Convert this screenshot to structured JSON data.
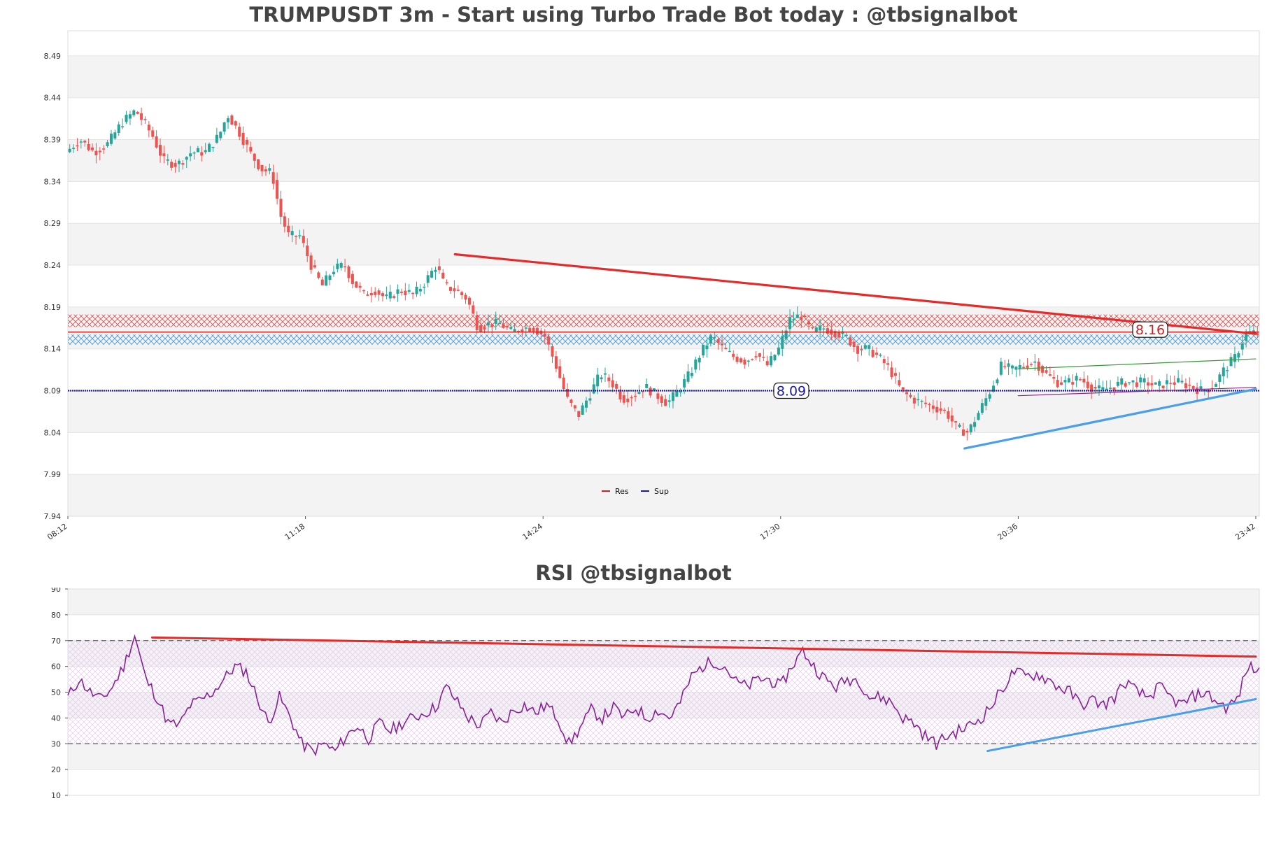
{
  "chart_data": [
    {
      "type": "candlestick",
      "title": "TRUMPUSDT 3m - Start using Turbo Trade Bot today : @tbsignalbot",
      "ylim": [
        7.94,
        8.52
      ],
      "y_ticks": [
        "8.49",
        "8.44",
        "8.39",
        "8.34",
        "8.29",
        "8.24",
        "8.19",
        "8.14",
        "8.09",
        "8.04",
        "7.99",
        "7.94"
      ],
      "x_ticks": [
        "08:12",
        "11:18",
        "14:24",
        "17:30",
        "20:36",
        "23:42"
      ],
      "n_candles": 316,
      "legend": {
        "placement": "bottom-center",
        "entries": [
          "Res",
          "Sup"
        ]
      },
      "levels": [
        {
          "name": "Res",
          "value": 8.16,
          "label": "8.16",
          "color": "#cc2222",
          "zone": [
            8.166,
            8.181
          ]
        },
        {
          "name": "Sup",
          "value": 8.09,
          "label": "8.09",
          "color": "#1a1aaa",
          "zone": [
            8.145,
            8.157
          ]
        }
      ],
      "trendlines": [
        {
          "name": "resistance-trend",
          "color": "#e52a2a",
          "from": [
            "13:15",
            8.253
          ],
          "to": [
            "23:42",
            8.158
          ]
        },
        {
          "name": "support-trend",
          "color": "#4a9fe8",
          "from": [
            "19:54",
            8.021
          ],
          "to": [
            "23:42",
            8.092
          ]
        },
        {
          "name": "channel-upper",
          "color": "#3a9a3a",
          "from": [
            "20:36",
            8.116
          ],
          "to": [
            "23:42",
            8.128
          ]
        },
        {
          "name": "channel-lower",
          "color": "#8a2a8a",
          "from": [
            "20:36",
            8.084
          ],
          "to": [
            "23:42",
            8.094
          ]
        }
      ],
      "anchors": [
        [
          0,
          8.375
        ],
        [
          5,
          8.39
        ],
        [
          10,
          8.375
        ],
        [
          15,
          8.385
        ],
        [
          20,
          8.41
        ],
        [
          25,
          8.425
        ],
        [
          28,
          8.41
        ],
        [
          31,
          8.395
        ],
        [
          35,
          8.365
        ],
        [
          40,
          8.36
        ],
        [
          45,
          8.375
        ],
        [
          50,
          8.375
        ],
        [
          55,
          8.395
        ],
        [
          58,
          8.42
        ],
        [
          62,
          8.4
        ],
        [
          66,
          8.375
        ],
        [
          70,
          8.355
        ],
        [
          74,
          8.35
        ],
        [
          77,
          8.3
        ],
        [
          80,
          8.275
        ],
        [
          84,
          8.275
        ],
        [
          88,
          8.24
        ],
        [
          92,
          8.215
        ],
        [
          96,
          8.235
        ],
        [
          100,
          8.24
        ],
        [
          103,
          8.22
        ],
        [
          107,
          8.205
        ],
        [
          111,
          8.21
        ],
        [
          115,
          8.2
        ],
        [
          120,
          8.21
        ],
        [
          125,
          8.205
        ],
        [
          129,
          8.22
        ],
        [
          133,
          8.24
        ],
        [
          136,
          8.215
        ],
        [
          140,
          8.21
        ],
        [
          144,
          8.2
        ],
        [
          148,
          8.165
        ],
        [
          152,
          8.17
        ],
        [
          156,
          8.17
        ],
        [
          160,
          8.16
        ],
        [
          164,
          8.165
        ],
        [
          168,
          8.165
        ],
        [
          172,
          8.155
        ],
        [
          176,
          8.12
        ],
        [
          180,
          8.08
        ],
        [
          184,
          8.06
        ],
        [
          188,
          8.085
        ],
        [
          192,
          8.11
        ],
        [
          196,
          8.1
        ],
        [
          200,
          8.08
        ],
        [
          204,
          8.085
        ],
        [
          208,
          8.095
        ],
        [
          212,
          8.085
        ],
        [
          216,
          8.075
        ],
        [
          220,
          8.09
        ],
        [
          224,
          8.11
        ],
        [
          228,
          8.135
        ],
        [
          232,
          8.155
        ],
        [
          236,
          8.14
        ],
        [
          240,
          8.13
        ],
        [
          244,
          8.125
        ],
        [
          248,
          8.135
        ],
        [
          252,
          8.12
        ],
        [
          256,
          8.14
        ],
        [
          260,
          8.175
        ],
        [
          264,
          8.18
        ],
        [
          268,
          8.16
        ],
        [
          272,
          8.165
        ],
        [
          276,
          8.16
        ],
        [
          280,
          8.155
        ],
        [
          284,
          8.14
        ],
        [
          288,
          8.14
        ],
        [
          292,
          8.13
        ],
        [
          296,
          8.115
        ],
        [
          300,
          8.09
        ],
        [
          304,
          8.08
        ],
        [
          308,
          8.075
        ],
        [
          312,
          8.07
        ],
        [
          316,
          8.065
        ],
        [
          320,
          8.045
        ],
        [
          324,
          8.04
        ],
        [
          328,
          8.065
        ],
        [
          332,
          8.09
        ],
        [
          336,
          8.12
        ],
        [
          340,
          8.115
        ],
        [
          344,
          8.12
        ],
        [
          348,
          8.125
        ],
        [
          352,
          8.11
        ],
        [
          356,
          8.1
        ],
        [
          360,
          8.1
        ],
        [
          364,
          8.105
        ],
        [
          368,
          8.095
        ],
        [
          372,
          8.09
        ],
        [
          376,
          8.095
        ],
        [
          380,
          8.1
        ],
        [
          384,
          8.1
        ],
        [
          388,
          8.1
        ],
        [
          392,
          8.095
        ],
        [
          396,
          8.1
        ],
        [
          400,
          8.1
        ],
        [
          404,
          8.095
        ],
        [
          408,
          8.09
        ],
        [
          412,
          8.095
        ],
        [
          416,
          8.115
        ],
        [
          420,
          8.13
        ],
        [
          424,
          8.16
        ],
        [
          428,
          8.158
        ]
      ]
    },
    {
      "type": "line",
      "title": "RSI @tbsignalbot",
      "ylim": [
        10,
        90
      ],
      "y_ticks": [
        "90",
        "80",
        "70",
        "60",
        "50",
        "40",
        "30",
        "20",
        "10"
      ],
      "overbought": 70,
      "oversold": 30,
      "series": [
        {
          "color": "#8a1f9a",
          "anchors": [
            [
              0,
              48
            ],
            [
              4,
              55
            ],
            [
              8,
              50
            ],
            [
              12,
              47
            ],
            [
              16,
              52
            ],
            [
              20,
              60
            ],
            [
              24,
              72
            ],
            [
              28,
              55
            ],
            [
              32,
              48
            ],
            [
              36,
              38
            ],
            [
              40,
              37
            ],
            [
              44,
              45
            ],
            [
              48,
              47
            ],
            [
              52,
              50
            ],
            [
              56,
              55
            ],
            [
              60,
              60
            ],
            [
              64,
              58
            ],
            [
              68,
              48
            ],
            [
              72,
              38
            ],
            [
              76,
              48
            ],
            [
              80,
              40
            ],
            [
              84,
              30
            ],
            [
              88,
              27
            ],
            [
              92,
              30
            ],
            [
              96,
              27
            ],
            [
              100,
              33
            ],
            [
              104,
              37
            ],
            [
              108,
              32
            ],
            [
              112,
              38
            ],
            [
              116,
              35
            ],
            [
              120,
              38
            ],
            [
              124,
              40
            ],
            [
              128,
              42
            ],
            [
              132,
              44
            ],
            [
              136,
              52
            ],
            [
              140,
              46
            ],
            [
              144,
              40
            ],
            [
              148,
              37
            ],
            [
              152,
              42
            ],
            [
              156,
              38
            ],
            [
              160,
              43
            ],
            [
              164,
              45
            ],
            [
              168,
              42
            ],
            [
              172,
              45
            ],
            [
              176,
              40
            ],
            [
              180,
              30
            ],
            [
              184,
              36
            ],
            [
              188,
              43
            ],
            [
              192,
              40
            ],
            [
              196,
              44
            ],
            [
              200,
              40
            ],
            [
              204,
              44
            ],
            [
              208,
              40
            ],
            [
              212,
              43
            ],
            [
              216,
              40
            ],
            [
              220,
              46
            ],
            [
              224,
              56
            ],
            [
              228,
              60
            ],
            [
              232,
              62
            ],
            [
              236,
              60
            ],
            [
              240,
              54
            ],
            [
              244,
              52
            ],
            [
              248,
              55
            ],
            [
              252,
              55
            ],
            [
              256,
              52
            ],
            [
              260,
              60
            ],
            [
              264,
              66
            ],
            [
              268,
              60
            ],
            [
              272,
              55
            ],
            [
              276,
              52
            ],
            [
              280,
              55
            ],
            [
              284,
              55
            ],
            [
              288,
              48
            ],
            [
              292,
              48
            ],
            [
              296,
              46
            ],
            [
              300,
              40
            ],
            [
              304,
              38
            ],
            [
              308,
              33
            ],
            [
              312,
              30
            ],
            [
              316,
              33
            ],
            [
              320,
              35
            ],
            [
              324,
              37
            ],
            [
              328,
              40
            ],
            [
              332,
              45
            ],
            [
              336,
              52
            ],
            [
              340,
              58
            ],
            [
              344,
              56
            ],
            [
              348,
              57
            ],
            [
              352,
              55
            ],
            [
              356,
              52
            ],
            [
              360,
              50
            ],
            [
              364,
              45
            ],
            [
              368,
              47
            ],
            [
              372,
              45
            ],
            [
              376,
              48
            ],
            [
              380,
              54
            ],
            [
              384,
              50
            ],
            [
              388,
              48
            ],
            [
              392,
              52
            ],
            [
              396,
              48
            ],
            [
              400,
              45
            ],
            [
              404,
              48
            ],
            [
              408,
              50
            ],
            [
              412,
              47
            ],
            [
              416,
              44
            ],
            [
              420,
              47
            ],
            [
              424,
              60
            ],
            [
              428,
              58
            ]
          ]
        }
      ],
      "trendlines": [
        {
          "name": "rsi-resistance-trend",
          "color": "#e52a2a",
          "from": [
            "09:18",
            71.2
          ],
          "to": [
            "23:42",
            63.8
          ]
        },
        {
          "name": "rsi-support-trend",
          "color": "#4a9fe8",
          "from": [
            "20:12",
            27.2
          ],
          "to": [
            "23:42",
            47.3
          ]
        }
      ]
    }
  ],
  "colors": {
    "bull": "#26a69a",
    "bear": "#ef5350",
    "res": "#cc2222",
    "sup": "#1a1aaa",
    "rsi": "#8a1f9a",
    "band": "#f3f3f3",
    "trend_res": "#e52a2a",
    "trend_sup": "#4a9fe8"
  }
}
